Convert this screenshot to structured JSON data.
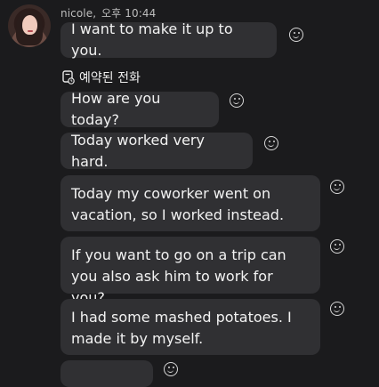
{
  "header": {
    "sender": "nicole",
    "time": "오후 10:44"
  },
  "messages": [
    {
      "text": "I want to make it up to you."
    },
    {
      "text": "How are you today?"
    },
    {
      "text": "Today worked very hard."
    },
    {
      "text": "Today my coworker went on vacation, so I worked instead."
    },
    {
      "text": "If you want to go on a trip can you also ask him to work for you?"
    },
    {
      "text": "I had some mashed potatoes. I made it by myself."
    },
    {
      "text": ""
    }
  ],
  "call": {
    "label": "예약된 전화",
    "icon": "scheduled-call-icon"
  },
  "icons": {
    "reaction": "add-reaction-icon"
  }
}
